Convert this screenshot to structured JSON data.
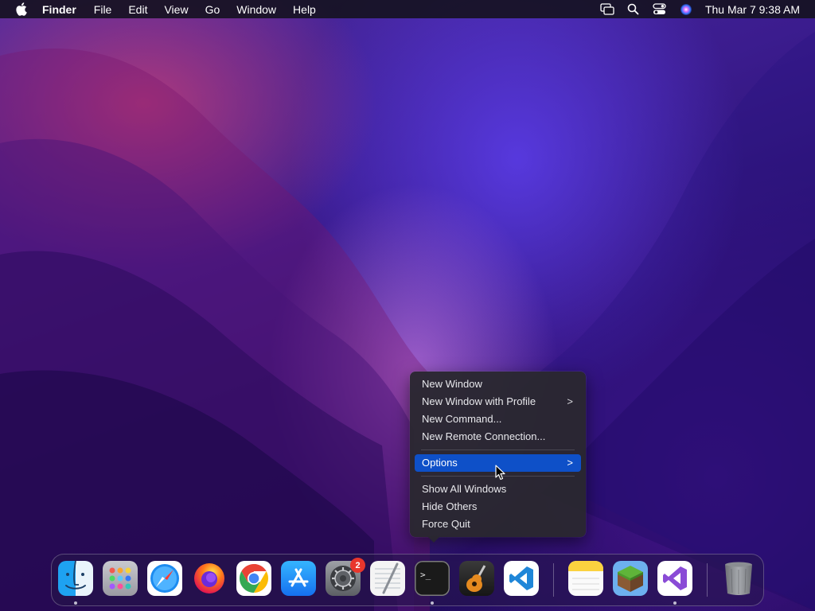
{
  "menubar": {
    "app_name": "Finder",
    "menus": [
      "File",
      "Edit",
      "View",
      "Go",
      "Window",
      "Help"
    ],
    "clock": "Thu Mar 7  9:38 AM"
  },
  "context_menu": {
    "items": [
      {
        "label": "New Window",
        "has_submenu": false
      },
      {
        "label": "New Window with Profile",
        "has_submenu": true
      },
      {
        "label": "New Command...",
        "has_submenu": false
      },
      {
        "label": "New Remote Connection...",
        "has_submenu": false
      },
      {
        "label": "Options",
        "has_submenu": true,
        "highlighted": true
      },
      {
        "label": "Show All Windows",
        "has_submenu": false
      },
      {
        "label": "Hide Others",
        "has_submenu": false
      },
      {
        "label": "Force Quit",
        "has_submenu": false
      }
    ],
    "chevron": ">",
    "highlight_color": "#0e50c8"
  },
  "dock": {
    "apps": [
      {
        "name": "finder-icon",
        "running": true
      },
      {
        "name": "launchpad-icon",
        "running": false
      },
      {
        "name": "safari-icon",
        "running": false
      },
      {
        "name": "firefox-icon",
        "running": false
      },
      {
        "name": "chrome-icon",
        "running": false
      },
      {
        "name": "app-store-icon",
        "running": false
      },
      {
        "name": "system-settings-icon",
        "running": false,
        "badge": "2"
      },
      {
        "name": "textedit-icon",
        "running": false
      },
      {
        "name": "terminal-icon",
        "running": true
      },
      {
        "name": "garageband-icon",
        "running": false
      },
      {
        "name": "vscode-icon",
        "running": false
      },
      {
        "name": "notes-icon",
        "running": false
      },
      {
        "name": "minecraft-icon",
        "running": false
      },
      {
        "name": "visual-studio-icon",
        "running": true
      },
      {
        "name": "trash-icon",
        "running": false
      }
    ],
    "badge_color": "#e8362c"
  }
}
